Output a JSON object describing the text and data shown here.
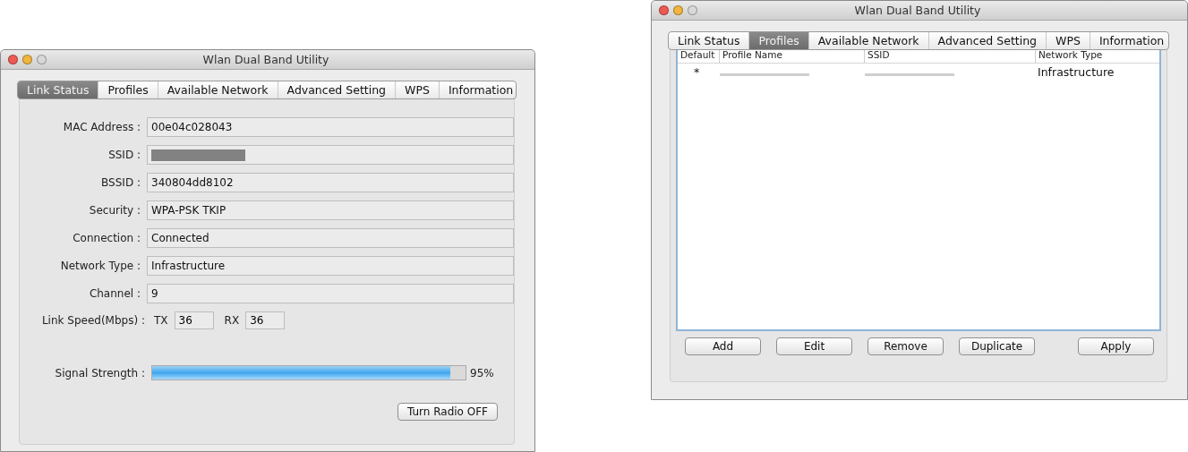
{
  "windows": [
    {
      "title": "Wlan Dual Band Utility",
      "kind": "link_status",
      "tabs": [
        {
          "label": "Link Status",
          "selected": true
        },
        {
          "label": "Profiles",
          "selected": false
        },
        {
          "label": "Available Network",
          "selected": false
        },
        {
          "label": "Advanced Setting",
          "selected": false
        },
        {
          "label": "WPS",
          "selected": false
        },
        {
          "label": "Information",
          "selected": false
        }
      ],
      "fields": [
        {
          "label": "MAC Address :",
          "value": "00e04c028043",
          "redacted": false
        },
        {
          "label": "SSID :",
          "redacted": true
        },
        {
          "label": "BSSID :",
          "value": "340804dd8102",
          "redacted": false
        },
        {
          "label": "Security :",
          "value": "WPA-PSK TKIP",
          "redacted": false
        },
        {
          "label": "Connection :",
          "value": "Connected",
          "redacted": false
        },
        {
          "label": "Network Type :",
          "value": "Infrastructure",
          "redacted": false
        },
        {
          "label": "Channel :",
          "value": "9",
          "redacted": false
        }
      ],
      "link_speed": {
        "label": "Link Speed(Mbps) :",
        "tx_label": "TX",
        "tx": "36",
        "rx_label": "RX",
        "rx": "36"
      },
      "signal": {
        "label": "Signal Strength :",
        "level": 0.95,
        "reading": "95%"
      },
      "buttons": [
        "Turn Radio OFF"
      ]
    },
    {
      "title": "Wlan Dual Band Utility",
      "kind": "profiles",
      "tabs": [
        {
          "label": "Link Status",
          "selected": false
        },
        {
          "label": "Profiles",
          "selected": true
        },
        {
          "label": "Available Network",
          "selected": false
        },
        {
          "label": "Advanced Setting",
          "selected": false
        },
        {
          "label": "WPS",
          "selected": false
        },
        {
          "label": "Information",
          "selected": false
        }
      ],
      "table": {
        "columns": [
          "Default",
          "Profile Name",
          "SSID",
          "Network Type"
        ],
        "rows": [
          {
            "default": "*",
            "network_type": "Infrastructure",
            "redacted": true
          }
        ]
      },
      "buttons": [
        "Add",
        "Edit",
        "Remove",
        "Duplicate",
        "Apply"
      ]
    }
  ]
}
